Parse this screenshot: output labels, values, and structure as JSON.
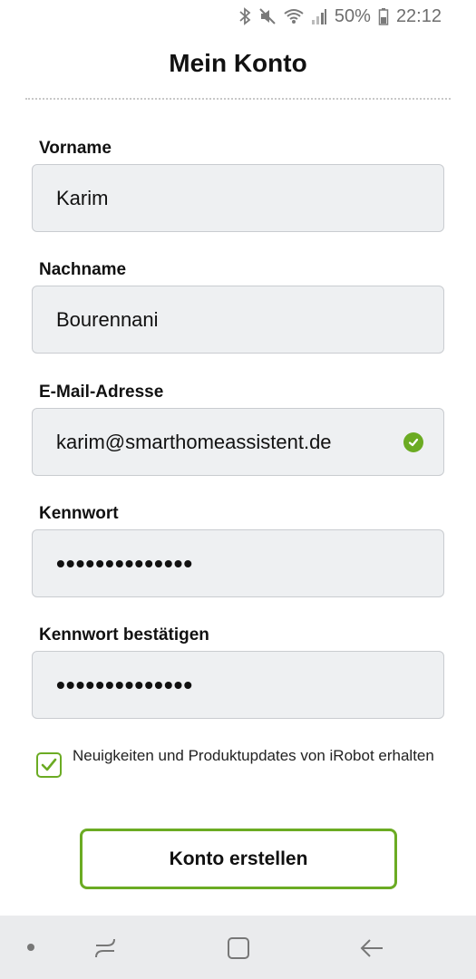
{
  "status_bar": {
    "battery_percent": "50%",
    "time": "22:12",
    "icons": [
      "bluetooth-icon",
      "mute-icon",
      "wifi-icon",
      "signal-icon",
      "battery-icon"
    ]
  },
  "header": {
    "title": "Mein Konto"
  },
  "form": {
    "first_name": {
      "label": "Vorname",
      "value": "Karim"
    },
    "last_name": {
      "label": "Nachname",
      "value": "Bourennani"
    },
    "email": {
      "label": "E-Mail-Adresse",
      "value": "karim@smarthomeassistent.de",
      "valid": true
    },
    "password": {
      "label": "Kennwort",
      "value": "••••••••••••••"
    },
    "password_confirm": {
      "label": "Kennwort bestätigen",
      "value": "••••••••••••••"
    }
  },
  "newsletter": {
    "checked": true,
    "label": "Neuigkeiten und Produktupdates von iRobot erhalten"
  },
  "actions": {
    "create_account": "Konto erstellen"
  },
  "colors": {
    "accent": "#6bab23",
    "field_bg": "#eef0f2",
    "nav_bg": "#eaebed"
  }
}
